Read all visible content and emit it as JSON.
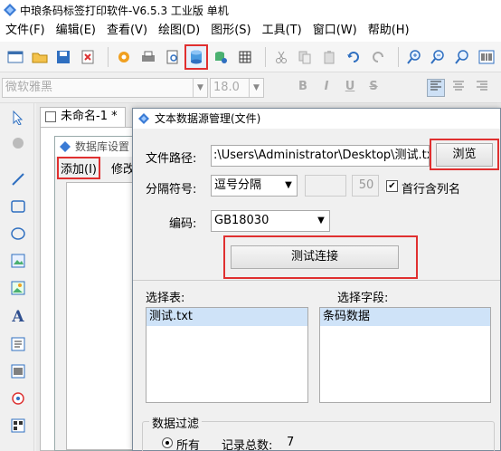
{
  "window": {
    "title": "中琅条码标签打印软件-V6.5.3 工业版 单机"
  },
  "menu": [
    {
      "label": "文件(F)"
    },
    {
      "label": "编辑(E)"
    },
    {
      "label": "查看(V)"
    },
    {
      "label": "绘图(D)"
    },
    {
      "label": "图形(S)"
    },
    {
      "label": "工具(T)"
    },
    {
      "label": "窗口(W)"
    },
    {
      "label": "帮助(H)"
    }
  ],
  "fontbar": {
    "font_name": "微软雅黑",
    "font_size": "18.0",
    "bold": "B",
    "italic": "I",
    "underline": "U",
    "strike": "S"
  },
  "document": {
    "tab_label": "未命名-1 *",
    "tab_close": "×"
  },
  "db_settings": {
    "title": "数据库设置",
    "add_menu": "添加(I)",
    "edit_menu": "修改"
  },
  "dialog": {
    "title": "文本数据源管理(文件)",
    "path_label": "文件路径:",
    "path_value": ":\\Users\\Administrator\\Desktop\\测试.txt",
    "browse_label": "浏览",
    "separator_label": "分隔符号:",
    "separator_value": "逗号分隔",
    "separator_custom": "",
    "separator_count": "50",
    "first_row_label": "首行含列名",
    "first_row_checked": true,
    "encoding_label": "编码:",
    "encoding_value": "GB18030",
    "test_button": "测试连接",
    "tables_label": "选择表:",
    "tables": [
      "测试.txt"
    ],
    "fields_label": "选择字段:",
    "fields": [
      "条码数据"
    ],
    "filter_label": "数据过滤",
    "filter_all": "所有",
    "record_count_label": "记录总数:",
    "record_count": "7"
  }
}
